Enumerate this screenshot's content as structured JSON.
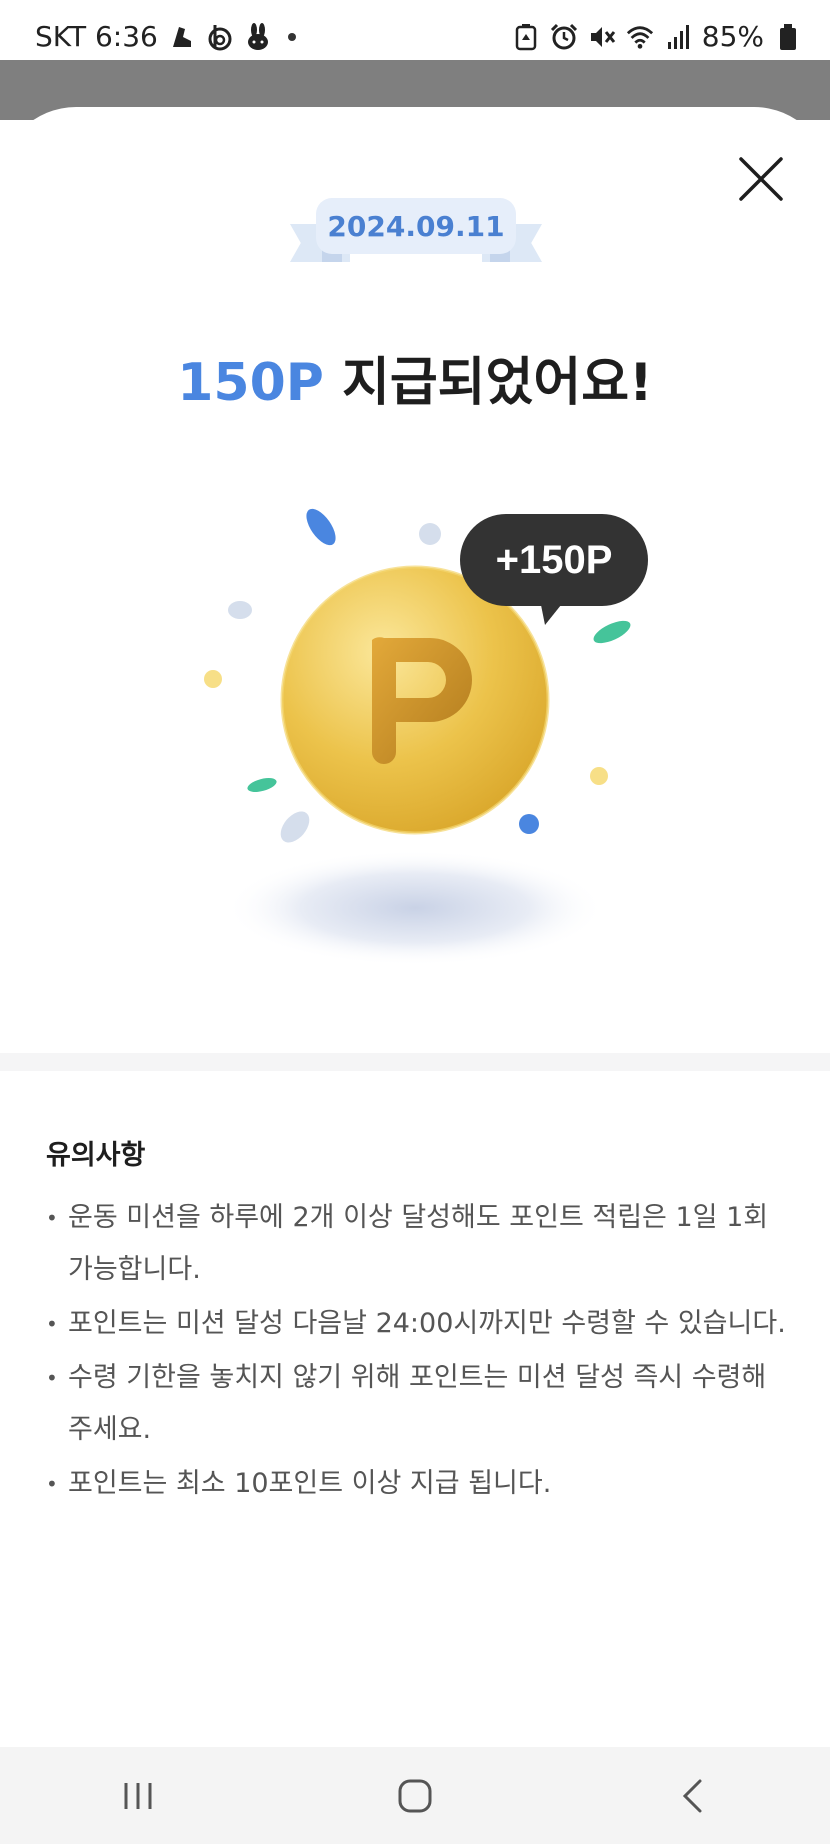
{
  "status_bar": {
    "carrier_time": "SKT 6:36",
    "battery": "85%",
    "icons_left": [
      "shoe-app-icon",
      "b-app-icon",
      "rabbit-app-icon",
      "dot-icon"
    ],
    "icons_right": [
      "recycle-battery-icon",
      "alarm-icon",
      "mute-icon",
      "wifi-icon",
      "signal-icon",
      "battery-icon"
    ]
  },
  "sheet": {
    "date": "2024.09.11",
    "headline_points": "150P",
    "headline_rest": " 지급되었어요!",
    "bubble": "+150P",
    "coin_letter": "P"
  },
  "notice": {
    "title": "유의사항",
    "items": [
      "운동 미션을 하루에 2개 이상 달성해도 포인트 적립은 1일 1회 가능합니다.",
      "포인트는 미션 달성 다음날 24:00시까지만 수령할 수 있습니다.",
      "수령 기한을 놓치지 않기 위해 포인트는 미션 달성 즉시 수령해 주세요.",
      "포인트는 최소 10포인트 이상 지급 됩니다."
    ]
  },
  "colors": {
    "accent": "#4a86e0",
    "coin": "#e9c04a",
    "bubble": "#333333"
  }
}
